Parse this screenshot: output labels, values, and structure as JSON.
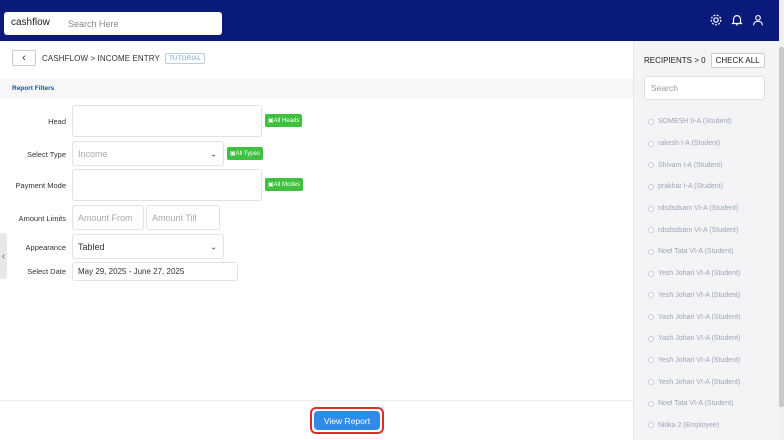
{
  "topbar": {
    "brand": "cashflow",
    "search_placeholder": "Search Here"
  },
  "breadcrumb": {
    "text": "CASHFLOW > INCOME ENTRY",
    "tutorial": "TUTORIAL"
  },
  "filters": {
    "title": "Report Filters",
    "head_label": "Head",
    "head_btn": "All Heads",
    "type_label": "Select Type",
    "type_value": "Income",
    "type_btn": "All Types",
    "mode_label": "Payment Mode",
    "mode_btn": "All Modes",
    "amount_label": "Amount Limits",
    "amount_from": "Amount From",
    "amount_till": "Amount Till",
    "appearance_label": "Appearance",
    "appearance_value": "Tabled",
    "date_label": "Select Date",
    "date_value": "May 29, 2025 - June 27, 2025"
  },
  "actions": {
    "view_report": "View Report"
  },
  "recipients": {
    "title": "RECIPIENTS > 0",
    "check_all": "CHECK ALL",
    "search_placeholder": "Search",
    "items": [
      "SOMESH II-A (Student)",
      "rakesh I-A (Student)",
      "Shivam I-A (Student)",
      "prakhar I-A (Student)",
      "rdsdsdsam VI-A (Student)",
      "rdsdsdsam VI-A (Student)",
      "Noel Tata VI-A (Student)",
      "Yesh Johari VI-A (Student)",
      "Yesh Johari VI-A (Student)",
      "Yash Johari VI-A (Student)",
      "Yash Johari VI-A (Student)",
      "Yesh Johari VI-A (Student)",
      "Yesh Johari VI-A (Student)",
      "Noel Tata VI-A (Student)",
      "Nitika 2 (Employee)"
    ]
  }
}
